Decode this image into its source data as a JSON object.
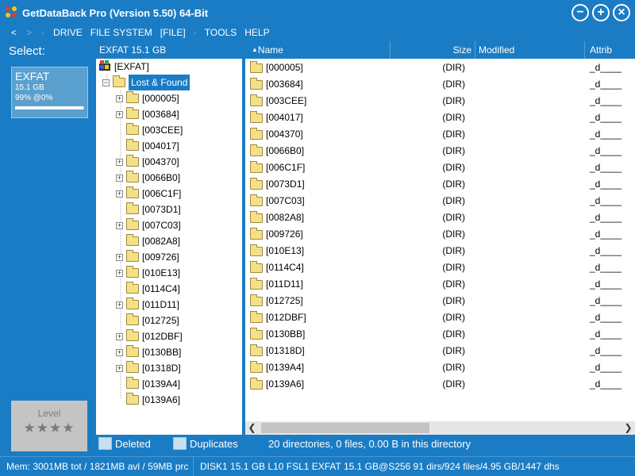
{
  "window": {
    "title": "GetDataBack Pro (Version 5.50) 64-Bit",
    "controls": [
      "−",
      "+",
      "×"
    ]
  },
  "menu": {
    "back": "<",
    "forward": ">",
    "up": "-",
    "items": [
      "DRIVE",
      "FILE SYSTEM",
      "[FILE]",
      "-",
      "TOOLS",
      "HELP"
    ]
  },
  "select_panel": {
    "label": "Select:",
    "drive": {
      "name": "EXFAT",
      "size": "15.1 GB",
      "status": "99% @0%",
      "progress": 0.99
    },
    "level": {
      "label": "Level",
      "stars": "★★★★"
    }
  },
  "tree": {
    "header": "EXFAT 15.1 GB",
    "root": "[EXFAT]",
    "selected": "Lost & Found",
    "children": [
      {
        "label": "[000005]",
        "expandable": true
      },
      {
        "label": "[003684]",
        "expandable": true
      },
      {
        "label": "[003CEE]",
        "expandable": false
      },
      {
        "label": "[004017]",
        "expandable": false
      },
      {
        "label": "[004370]",
        "expandable": true
      },
      {
        "label": "[0066B0]",
        "expandable": true
      },
      {
        "label": "[006C1F]",
        "expandable": true
      },
      {
        "label": "[0073D1]",
        "expandable": false
      },
      {
        "label": "[007C03]",
        "expandable": true
      },
      {
        "label": "[0082A8]",
        "expandable": false
      },
      {
        "label": "[009726]",
        "expandable": true
      },
      {
        "label": "[010E13]",
        "expandable": true
      },
      {
        "label": "[0114C4]",
        "expandable": false
      },
      {
        "label": "[011D11]",
        "expandable": true
      },
      {
        "label": "[012725]",
        "expandable": false
      },
      {
        "label": "[012DBF]",
        "expandable": true
      },
      {
        "label": "[0130BB]",
        "expandable": true
      },
      {
        "label": "[01318D]",
        "expandable": true
      },
      {
        "label": "[0139A4]",
        "expandable": false
      },
      {
        "label": "[0139A6]",
        "expandable": false
      }
    ]
  },
  "list": {
    "columns": {
      "name": "Name",
      "size": "Size",
      "modified": "Modified",
      "attrib": "Attrib"
    },
    "sort_arrow": "▲",
    "rows": [
      {
        "name": "[000005]",
        "size": "(DIR)",
        "modified": "",
        "attrib": "_d____"
      },
      {
        "name": "[003684]",
        "size": "(DIR)",
        "modified": "",
        "attrib": "_d____"
      },
      {
        "name": "[003CEE]",
        "size": "(DIR)",
        "modified": "",
        "attrib": "_d____"
      },
      {
        "name": "[004017]",
        "size": "(DIR)",
        "modified": "",
        "attrib": "_d____"
      },
      {
        "name": "[004370]",
        "size": "(DIR)",
        "modified": "",
        "attrib": "_d____"
      },
      {
        "name": "[0066B0]",
        "size": "(DIR)",
        "modified": "",
        "attrib": "_d____"
      },
      {
        "name": "[006C1F]",
        "size": "(DIR)",
        "modified": "",
        "attrib": "_d____"
      },
      {
        "name": "[0073D1]",
        "size": "(DIR)",
        "modified": "",
        "attrib": "_d____"
      },
      {
        "name": "[007C03]",
        "size": "(DIR)",
        "modified": "",
        "attrib": "_d____"
      },
      {
        "name": "[0082A8]",
        "size": "(DIR)",
        "modified": "",
        "attrib": "_d____"
      },
      {
        "name": "[009726]",
        "size": "(DIR)",
        "modified": "",
        "attrib": "_d____"
      },
      {
        "name": "[010E13]",
        "size": "(DIR)",
        "modified": "",
        "attrib": "_d____"
      },
      {
        "name": "[0114C4]",
        "size": "(DIR)",
        "modified": "",
        "attrib": "_d____"
      },
      {
        "name": "[011D11]",
        "size": "(DIR)",
        "modified": "",
        "attrib": "_d____"
      },
      {
        "name": "[012725]",
        "size": "(DIR)",
        "modified": "",
        "attrib": "_d____"
      },
      {
        "name": "[012DBF]",
        "size": "(DIR)",
        "modified": "",
        "attrib": "_d____"
      },
      {
        "name": "[0130BB]",
        "size": "(DIR)",
        "modified": "",
        "attrib": "_d____"
      },
      {
        "name": "[01318D]",
        "size": "(DIR)",
        "modified": "",
        "attrib": "_d____"
      },
      {
        "name": "[0139A4]",
        "size": "(DIR)",
        "modified": "",
        "attrib": "_d____"
      },
      {
        "name": "[0139A6]",
        "size": "(DIR)",
        "modified": "",
        "attrib": "_d____"
      }
    ]
  },
  "filters": {
    "deleted": "Deleted",
    "duplicates": "Duplicates"
  },
  "dir_info": "20 directories, 0 files, 0.00 B in this directory",
  "status": {
    "memory": "Mem: 3001MB tot / 1821MB avl / 59MB prc",
    "disk": "DISK1 15.1 GB L10 FSL1 EXFAT 15.1 GB@S256 91 dirs/924 files/4.95 GB/1447 dhs"
  },
  "colors": {
    "accent": "#1a7cc4",
    "selection": "#1a7cc4",
    "panel_bg": "#ffffff",
    "folder": "#f5e08a"
  },
  "icons": {
    "app": "app-logo-icon",
    "folder": "folder-icon",
    "drive": "drive-root-icon",
    "expand": "plus-expander-icon"
  }
}
